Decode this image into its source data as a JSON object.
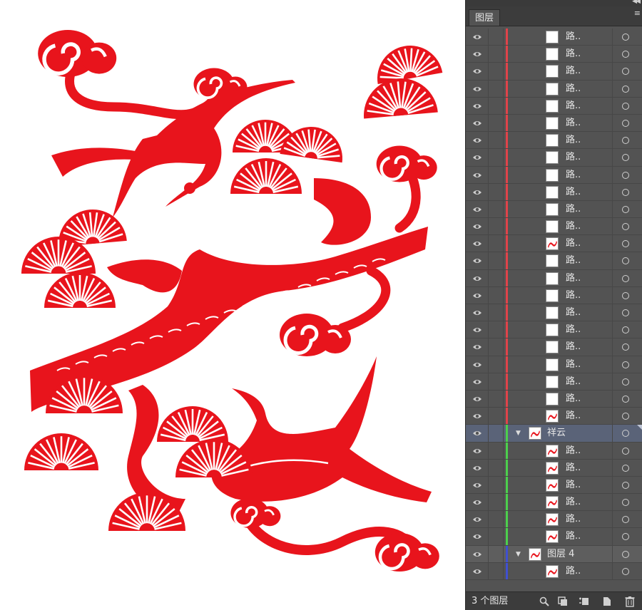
{
  "panel": {
    "tab_label": "图层",
    "tab_menu_icon": "panel-menu-icon",
    "collapse_icon": "double-chevron-left-icon",
    "footer_text": "3 个图层",
    "footer_icons": [
      "search-icon",
      "make-clipping-mask-icon",
      "create-sublayer-icon",
      "new-layer-icon",
      "delete-icon"
    ],
    "item_name": "路..",
    "layer_cloud": "祥云",
    "layer_four": "图层 4"
  },
  "colors": {
    "papercut_red": "#e8141c",
    "layer1_color": "#e0434a",
    "layer_cloud_color": "#4ccf4c",
    "layer4_color": "#4050d0",
    "panel_bg": "#535353"
  }
}
